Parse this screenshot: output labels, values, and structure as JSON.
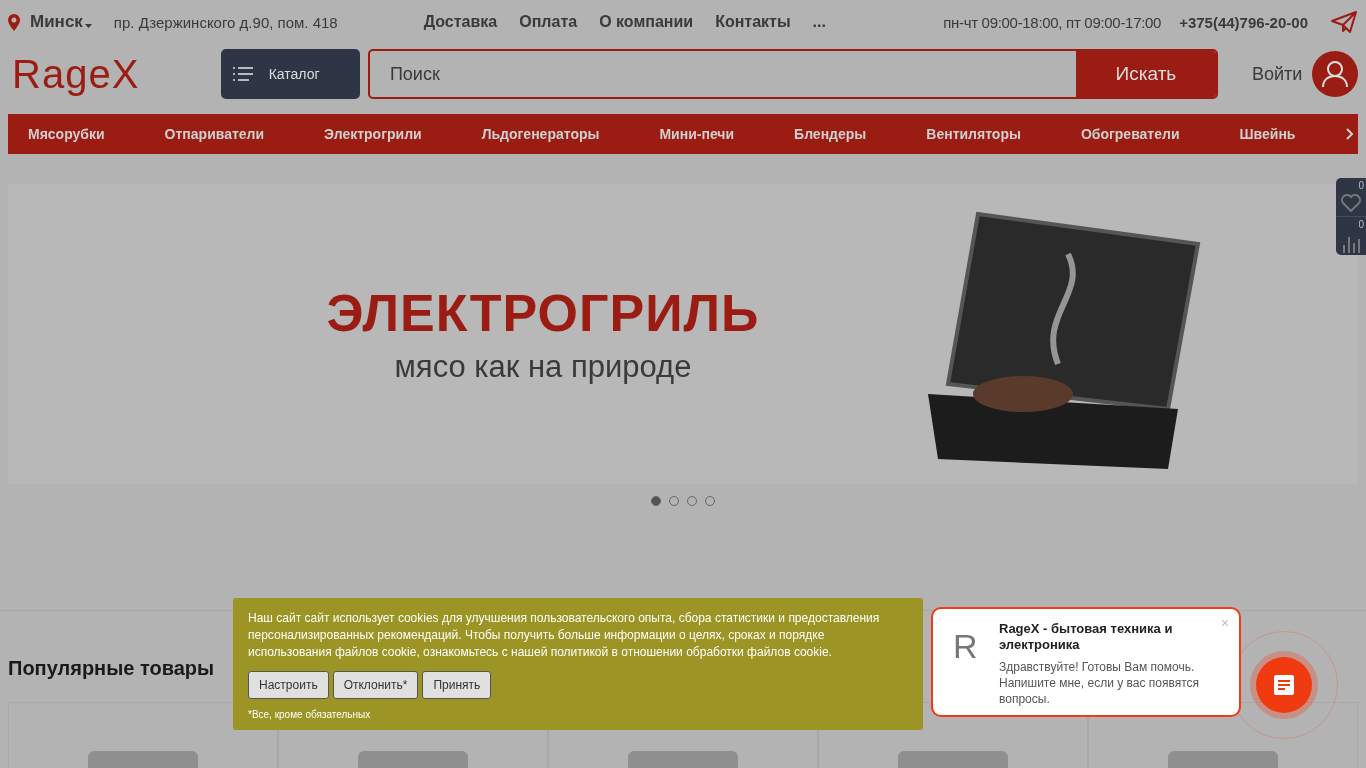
{
  "top_bar": {
    "city": "Минск",
    "address": "пр. Дзержинского д.90, пом. 418",
    "links": [
      "Доставка",
      "Оплата",
      "О компании",
      "Контакты",
      "..."
    ],
    "hours": "пн-чт 09:00-18:00, пт 09:00-17:00",
    "phone": "+375(44)796-20-00"
  },
  "header": {
    "logo": "RageX",
    "catalog_button": "Каталог",
    "search": {
      "placeholder": "Поиск"
    },
    "search_button": "Искать",
    "login": "Войти"
  },
  "categories": [
    "Мясорубки",
    "Отпариватели",
    "Электрогрили",
    "Льдогенераторы",
    "Мини-печи",
    "Блендеры",
    "Вентиляторы",
    "Обогреватели",
    "Швейнь"
  ],
  "side_counters": [
    {
      "kind": "favorites",
      "count": "0"
    },
    {
      "kind": "compare",
      "count": "0"
    }
  ],
  "hero": {
    "title": "ЭЛЕКТРОГРИЛЬ",
    "subtitle": "мясо как на природе",
    "dots": [
      {
        "selected": true
      },
      {
        "selected": false
      },
      {
        "selected": false
      },
      {
        "selected": false
      }
    ]
  },
  "popular": {
    "title": "Популярные товары"
  },
  "cookie_banner": {
    "text": "Наш сайт сайт использует cookies для улучшения пользовательского опыта, сбора статистики и предоставления персонализированных рекомендаций. Чтобы получить больше информации о целях, сроках и порядке использования файлов cookie, ознакомьтесь с нашей политикой в отношении обработки файлов cookie.",
    "buttons": [
      "Настроить",
      "Отклонить*",
      "Принять"
    ],
    "note": "*Все, кроме обязательных"
  },
  "chat_popup": {
    "logo_letter": "R",
    "close": "×",
    "title": "RageX - бытовая техника и электроника",
    "message": "Здравствуйте! Готовы Вам помочь. Напишите мне, если у вас появятся вопросы."
  }
}
